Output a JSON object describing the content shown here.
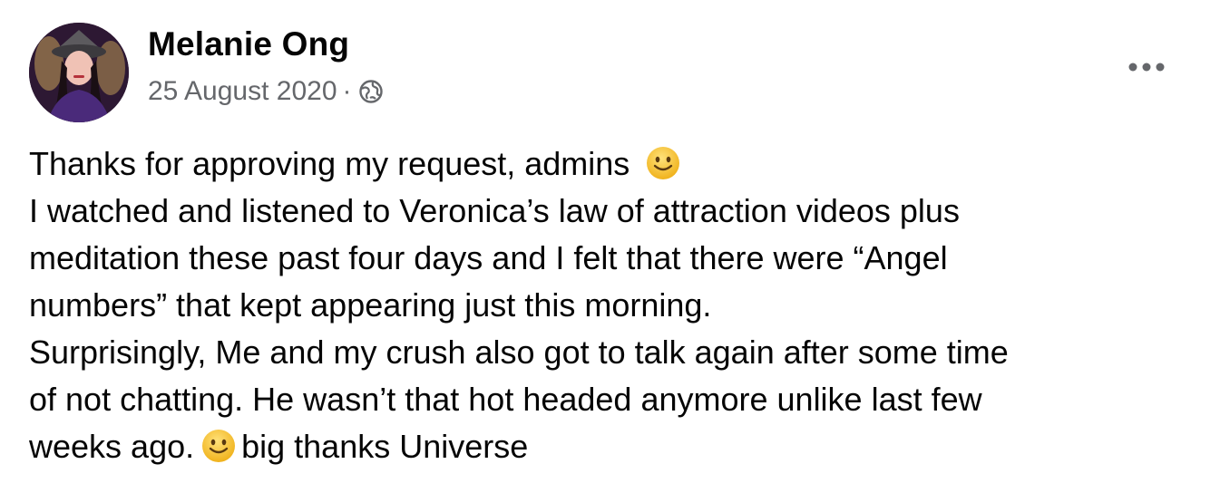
{
  "post": {
    "author": "Melanie Ong",
    "date": "25 August 2020",
    "separator": "·",
    "audience_icon": "globe-icon",
    "more_icon": "more-options-icon",
    "emoji_icon": "slightly-smiling-face-emoji",
    "body": {
      "line1": "Thanks for approving my request, admins",
      "line2": "I watched and listened to Veronica’s law of attraction videos plus",
      "line3": "meditation these past four days and I felt that there were “Angel",
      "line4": "numbers” that kept appearing just this morning.",
      "line5": "Surprisingly, Me and my crush also got to talk again after some time",
      "line6": "of not chatting. He wasn’t that hot headed anymore unlike last few",
      "line7_start": "weeks ago.",
      "line7_end": "big thanks Universe"
    }
  },
  "colors": {
    "text_primary": "#050505",
    "text_secondary": "#65676b",
    "emoji_face": "#f7c325"
  }
}
